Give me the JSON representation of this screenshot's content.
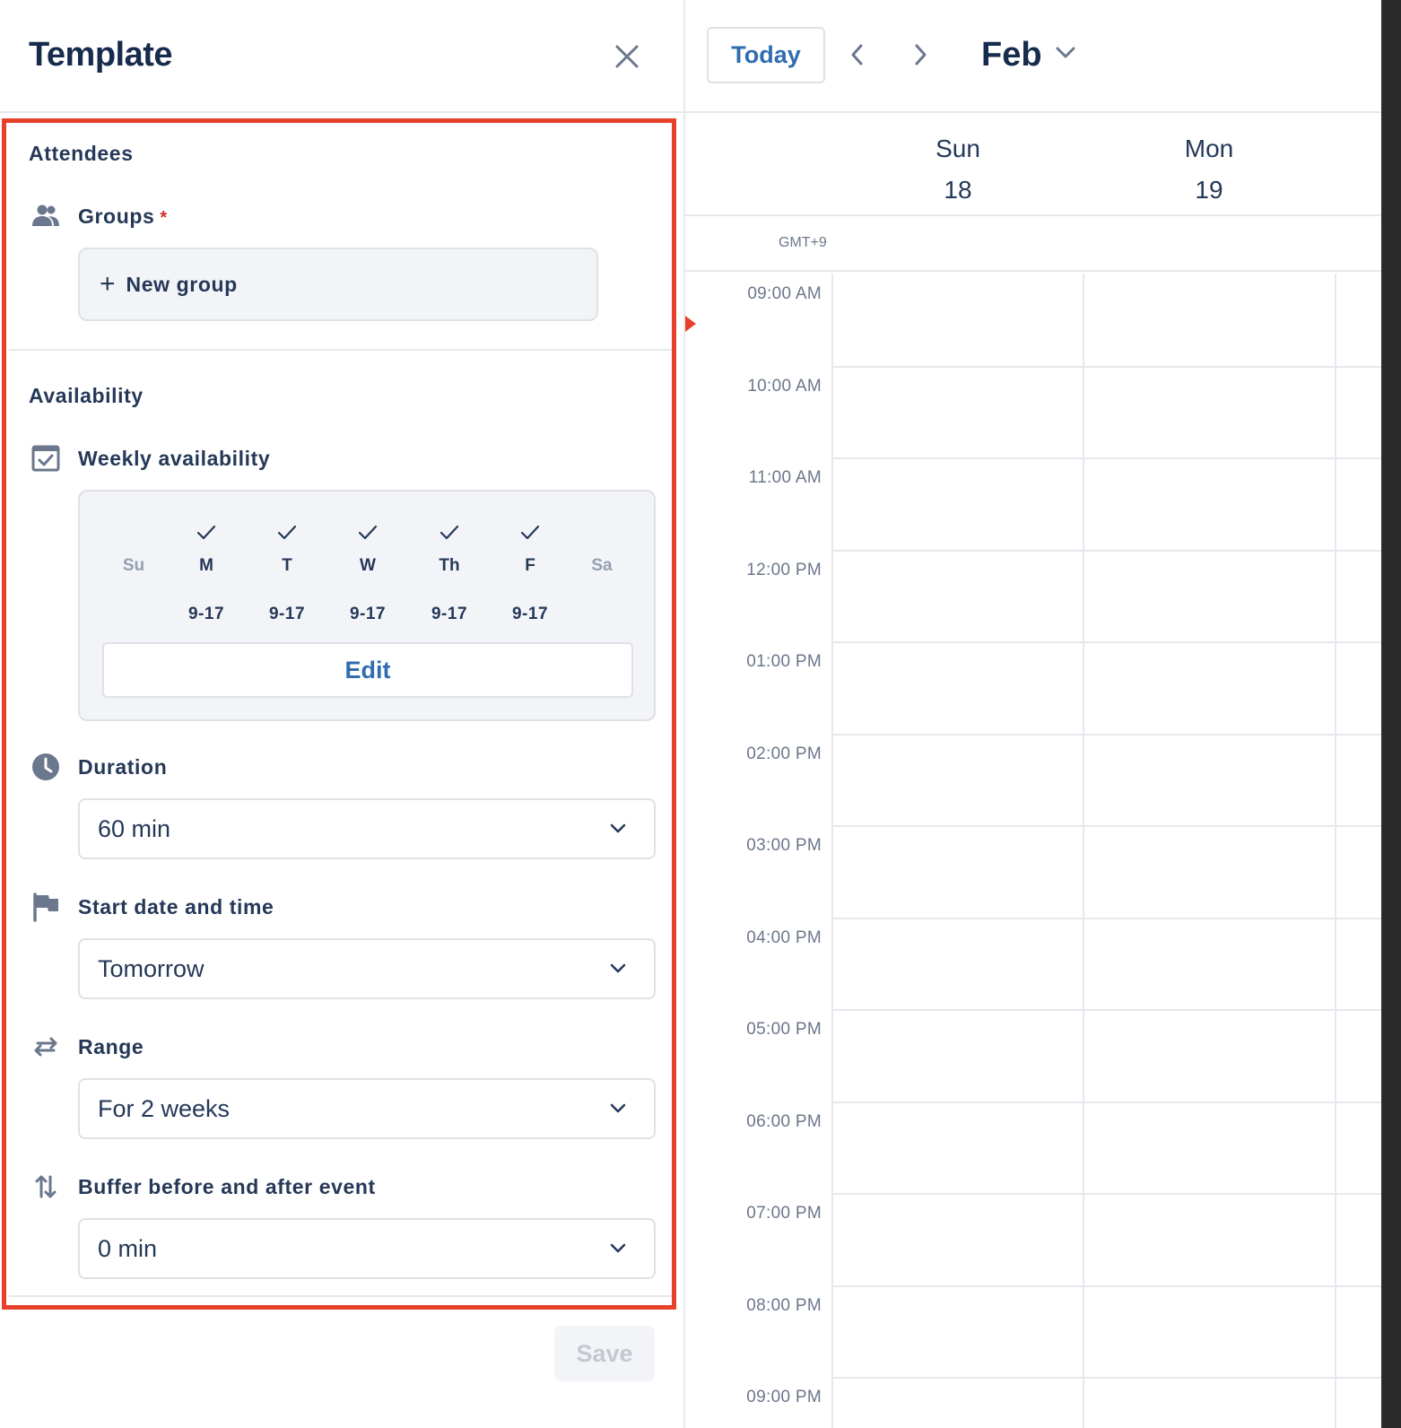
{
  "panel": {
    "title": "Template",
    "attendees": {
      "section_title": "Attendees",
      "groups_label": "Groups",
      "required_mark": "*",
      "new_group_label": "New group",
      "plus_glyph": "+"
    },
    "availability": {
      "section_title": "Availability",
      "weekly_label": "Weekly availability",
      "days": [
        {
          "name": "Su",
          "time": "",
          "checked": false
        },
        {
          "name": "M",
          "time": "9-17",
          "checked": true
        },
        {
          "name": "T",
          "time": "9-17",
          "checked": true
        },
        {
          "name": "W",
          "time": "9-17",
          "checked": true
        },
        {
          "name": "Th",
          "time": "9-17",
          "checked": true
        },
        {
          "name": "F",
          "time": "9-17",
          "checked": true
        },
        {
          "name": "Sa",
          "time": "",
          "checked": false
        }
      ],
      "edit_label": "Edit",
      "duration_label": "Duration",
      "duration_value": "60 min",
      "start_label": "Start date and time",
      "start_value": "Tomorrow",
      "range_label": "Range",
      "range_value": "For 2 weeks",
      "buffer_label": "Buffer before and after event",
      "buffer_value": "0 min"
    },
    "save_label": "Save"
  },
  "calendar": {
    "today_label": "Today",
    "month": "Feb",
    "timezone": "GMT+9",
    "days": [
      {
        "name": "Sun",
        "date": "18"
      },
      {
        "name": "Mon",
        "date": "19"
      }
    ],
    "hours": [
      "09:00 AM",
      "10:00 AM",
      "11:00 AM",
      "12:00 PM",
      "01:00 PM",
      "02:00 PM",
      "03:00 PM",
      "04:00 PM",
      "05:00 PM",
      "06:00 PM",
      "07:00 PM",
      "08:00 PM",
      "09:00 PM"
    ]
  },
  "colors": {
    "highlight": "#e8412b",
    "accent": "#2f6db0",
    "text": "#253858",
    "icon": "#6b778c"
  },
  "icons": {
    "close": "close-icon",
    "groups": "people-icon",
    "weekly": "calendar-check-icon",
    "duration": "clock-icon",
    "start": "flag-icon",
    "range": "swap-horizontal-icon",
    "buffer": "swap-vertical-icon",
    "chevron": "chevron-down-icon"
  }
}
